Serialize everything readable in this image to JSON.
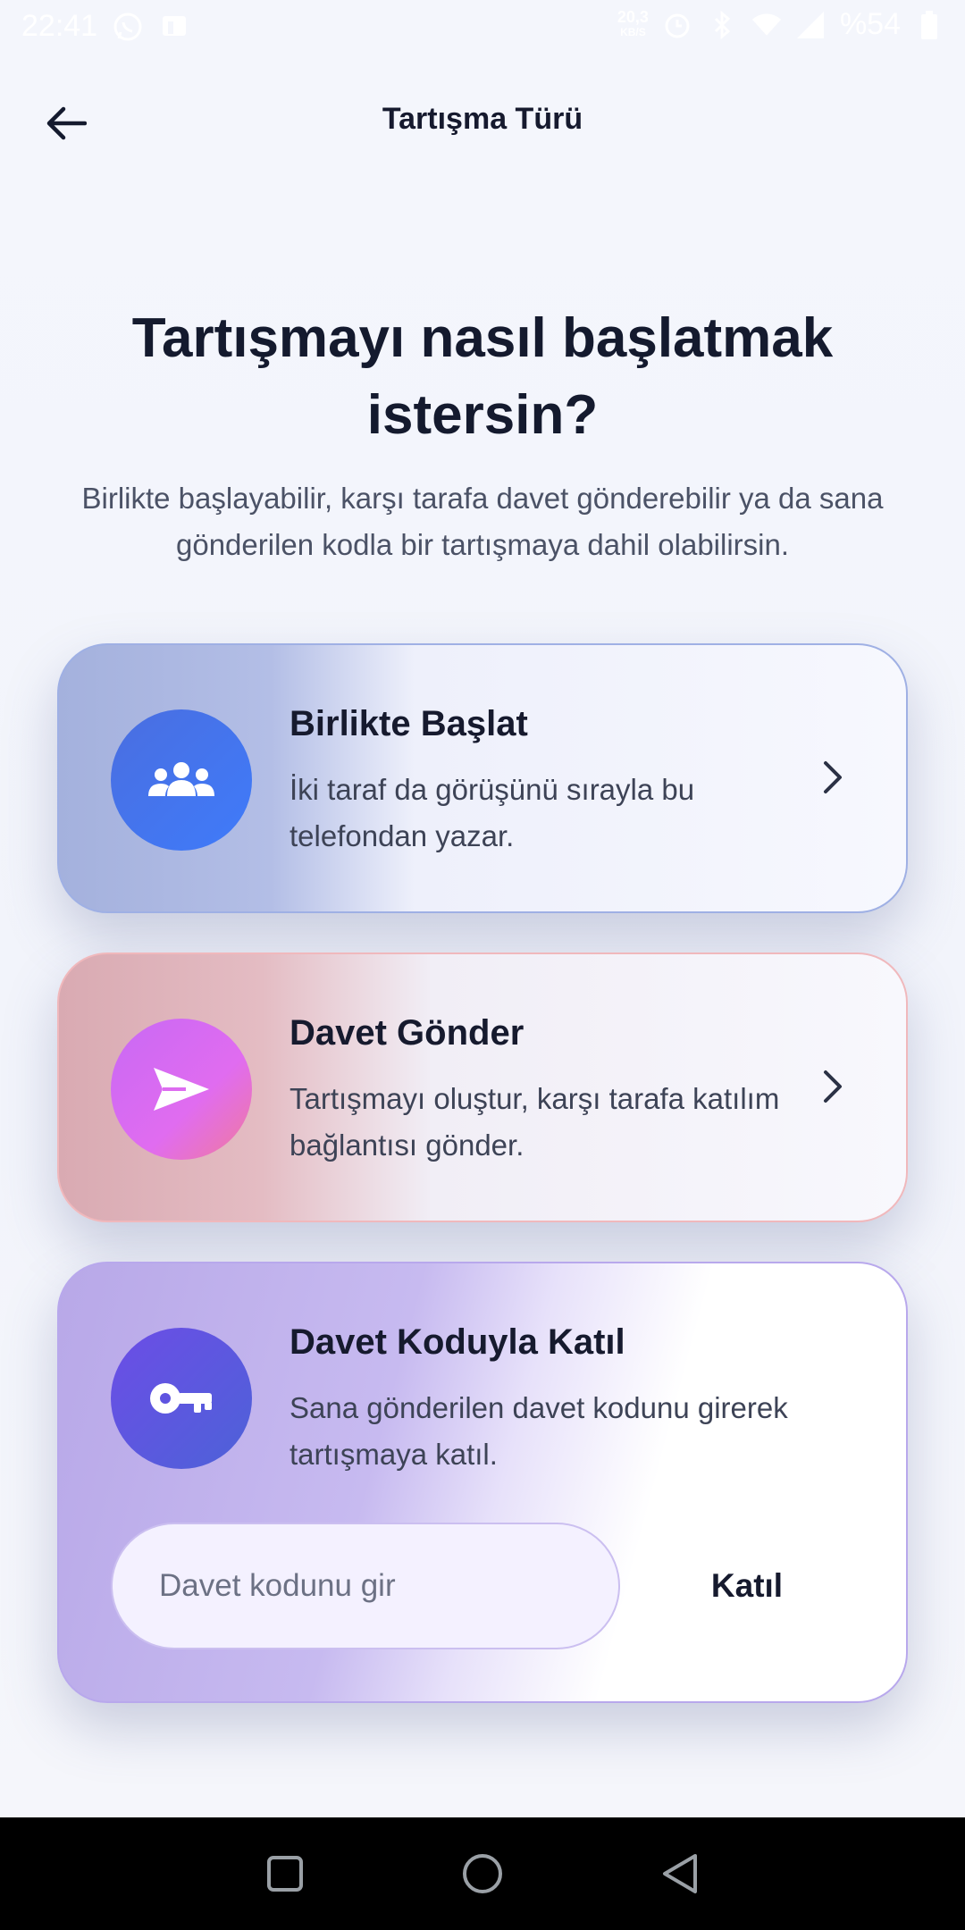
{
  "status_bar": {
    "time": "22:41",
    "net_speed_value": "20,3",
    "net_speed_unit": "KB/S",
    "battery": "%54",
    "icons": [
      "whatsapp-icon",
      "app-icon",
      "alarm-icon",
      "bluetooth-icon",
      "wifi-icon",
      "signal-icon",
      "battery-icon"
    ]
  },
  "header": {
    "title": "Tartışma Türü",
    "back_icon": "arrow-left-icon"
  },
  "main": {
    "headline": "Tartışmayı nasıl başlatmak istersin?",
    "subtitle": "Birlikte başlayabilir, karşı tarafa davet gönderebilir ya da sana gönderilen kodla bir tartışmaya dahil olabilirsin."
  },
  "options": [
    {
      "title": "Birlikte Başlat",
      "description": "İki taraf da görüşünü sırayla bu telefondan yazar.",
      "icon": "group-icon"
    },
    {
      "title": "Davet Gönder",
      "description": "Tartışmayı oluştur, karşı tarafa katılım bağlantısı gönder.",
      "icon": "send-icon"
    },
    {
      "title": "Davet Koduyla Katıl",
      "description": "Sana gönderilen davet kodunu girerek tartışmaya katıl.",
      "icon": "key-icon",
      "input_value": "",
      "input_placeholder": "Davet kodunu gir",
      "button_label": "Katıl"
    }
  ],
  "nav_bar": {
    "buttons": [
      "recents-square-icon",
      "home-circle-icon",
      "back-triangle-icon"
    ]
  },
  "colors": {
    "background": "#f4f6fc",
    "text_primary": "#161a2e",
    "text_secondary": "#4b5266",
    "card1_icon": "#4272f0",
    "card2_icon": "#d96cf2",
    "card3_icon": "#5a57df"
  }
}
